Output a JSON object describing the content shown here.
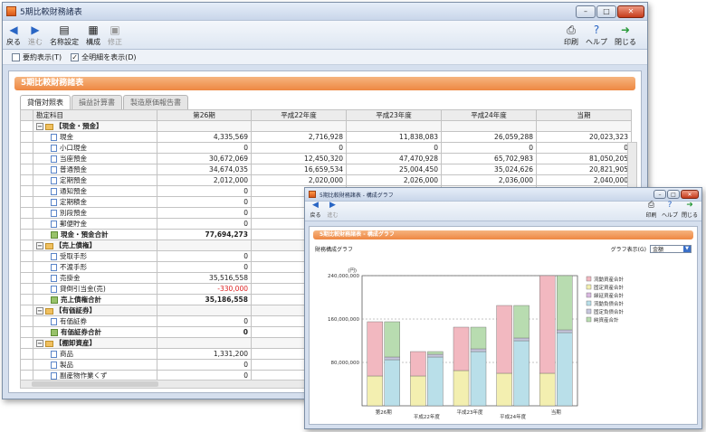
{
  "main": {
    "title": "5期比較財務諸表",
    "toolbar": {
      "back": "戻る",
      "forward": "進む",
      "name_settings": "名称設定",
      "structure": "構成",
      "revise": "修正",
      "print": "印刷",
      "help": "ヘルプ",
      "close": "閉じる"
    },
    "options": {
      "tree_show": "要約表示(T)",
      "all_show": "全明細を表示(D)",
      "all_checked": true
    },
    "header_bar": "5期比較財務諸表",
    "tabs": [
      "貸借対照表",
      "損益計算書",
      "製造原価報告書"
    ],
    "columns": [
      "",
      "勘定科目",
      "第26期",
      "平成22年度",
      "平成23年度",
      "平成24年度",
      "当期"
    ],
    "rows": [
      {
        "type": "cat",
        "label": "【現金・預金】",
        "v": [
          "",
          "",
          "",
          "",
          ""
        ]
      },
      {
        "type": "item",
        "label": "現金",
        "v": [
          "4,335,569",
          "2,716,928",
          "11,838,083",
          "26,059,288",
          "20,023,323"
        ]
      },
      {
        "type": "item",
        "label": "小口現金",
        "v": [
          "0",
          "0",
          "0",
          "0",
          "0"
        ]
      },
      {
        "type": "item",
        "label": "当座預金",
        "v": [
          "30,672,069",
          "12,450,320",
          "47,470,928",
          "65,702,983",
          "81,050,205"
        ]
      },
      {
        "type": "item",
        "label": "普通預金",
        "v": [
          "34,674,035",
          "16,659,534",
          "25,004,450",
          "35,024,626",
          "20,821,905"
        ]
      },
      {
        "type": "item",
        "label": "定期預金",
        "v": [
          "2,012,000",
          "2,020,000",
          "2,026,000",
          "2,036,000",
          "2,040,000"
        ]
      },
      {
        "type": "item",
        "label": "通知預金",
        "v": [
          "0",
          "",
          "",
          "",
          ""
        ]
      },
      {
        "type": "item",
        "label": "定期積金",
        "v": [
          "0",
          "",
          "",
          "",
          ""
        ]
      },
      {
        "type": "item",
        "label": "別段預金",
        "v": [
          "0",
          "",
          "",
          "",
          ""
        ]
      },
      {
        "type": "item",
        "label": "郵便貯金",
        "v": [
          "0",
          "",
          "",
          "",
          ""
        ]
      },
      {
        "type": "sum",
        "label": "現金・預金合計",
        "v": [
          "77,694,273",
          "",
          "",
          "",
          ""
        ]
      },
      {
        "type": "cat",
        "label": "【売上債権】",
        "v": [
          "",
          "",
          "",
          "",
          ""
        ]
      },
      {
        "type": "item",
        "label": "受取手形",
        "v": [
          "0",
          "",
          "",
          "",
          ""
        ]
      },
      {
        "type": "item",
        "label": "不渡手形",
        "v": [
          "0",
          "",
          "",
          "",
          ""
        ]
      },
      {
        "type": "item",
        "label": "売掛金",
        "v": [
          "35,516,558",
          "",
          "",
          "",
          ""
        ]
      },
      {
        "type": "item",
        "label": "貸倒引当金(売)",
        "neg": true,
        "v": [
          "-330,000",
          "",
          "",
          "",
          ""
        ]
      },
      {
        "type": "sum",
        "label": "売上債権合計",
        "v": [
          "35,186,558",
          "",
          "",
          "",
          ""
        ]
      },
      {
        "type": "cat",
        "label": "【有価証券】",
        "v": [
          "",
          "",
          "",
          "",
          ""
        ]
      },
      {
        "type": "item",
        "label": "有価証券",
        "v": [
          "0",
          "",
          "",
          "",
          ""
        ]
      },
      {
        "type": "sum",
        "label": "有価証券合計",
        "v": [
          "0",
          "",
          "",
          "",
          ""
        ]
      },
      {
        "type": "cat",
        "label": "【棚卸資産】",
        "v": [
          "",
          "",
          "",
          "",
          ""
        ]
      },
      {
        "type": "item",
        "label": "商品",
        "v": [
          "1,331,200",
          "",
          "",
          "",
          ""
        ]
      },
      {
        "type": "item",
        "label": "製品",
        "v": [
          "0",
          "",
          "",
          "",
          ""
        ]
      },
      {
        "type": "item",
        "label": "副産物作業くず",
        "v": [
          "0",
          "",
          "",
          "",
          ""
        ]
      }
    ]
  },
  "chartwin": {
    "title": "5期比較財務諸表 - 構成グラフ",
    "toolbar": {
      "back": "戻る",
      "forward": "進む",
      "print": "印刷",
      "help": "ヘルプ",
      "close": "閉じる"
    },
    "header_bar": "5期比較財務諸表 - 構成グラフ",
    "subtitle": "財務構成グラフ",
    "select_label": "グラフ表示(G)",
    "select_value": "金額",
    "unit": "(円)"
  },
  "chart_data": {
    "type": "bar",
    "stacked": true,
    "title": "",
    "ylim": [
      0,
      240000000
    ],
    "yticks": [
      "240,000,000",
      "160,000,000",
      "80,000,000"
    ],
    "categories": [
      "第26期",
      "平成22年度",
      "平成23年度",
      "平成24年度",
      "当期"
    ],
    "series": [
      {
        "name": "流動資産合計",
        "color": "#f2b8c0",
        "values": [
          [
            0,
            155000000
          ],
          [
            0,
            100000000
          ],
          [
            0,
            145000000
          ],
          [
            0,
            185000000
          ],
          [
            0,
            240000000
          ]
        ]
      },
      {
        "name": "固定資産合計",
        "color": "#f3efb0",
        "values": [
          [
            0,
            55000000
          ],
          [
            0,
            55000000
          ],
          [
            0,
            65000000
          ],
          [
            0,
            60000000
          ],
          [
            0,
            60000000
          ]
        ]
      },
      {
        "name": "流動負債合計",
        "color": "#b9dfe9",
        "values": [
          [
            0,
            85000000
          ],
          [
            0,
            90000000
          ],
          [
            0,
            100000000
          ],
          [
            0,
            120000000
          ],
          [
            0,
            135000000
          ]
        ]
      },
      {
        "name": "固定負債合計",
        "color": "#c6c6dd",
        "values": [
          [
            0,
            0
          ],
          [
            0,
            0
          ],
          [
            0,
            0
          ],
          [
            0,
            0
          ],
          [
            0,
            0
          ]
        ]
      },
      {
        "name": "純資産合計",
        "color": "#b8dcb0",
        "values": [
          [
            0,
            155000000
          ],
          [
            0,
            100000000
          ],
          [
            0,
            145000000
          ],
          [
            0,
            185000000
          ],
          [
            0,
            240000000
          ]
        ]
      }
    ],
    "legend": [
      "流動資産合計",
      "固定資産合計",
      "繰延資産合計",
      "流動負債合計",
      "固定負債合計",
      "純資産合計"
    ],
    "legend_colors": [
      "#f2b8c0",
      "#f3efb0",
      "#d9b8e0",
      "#b9dfe9",
      "#c6c6dd",
      "#b8dcb0"
    ]
  }
}
